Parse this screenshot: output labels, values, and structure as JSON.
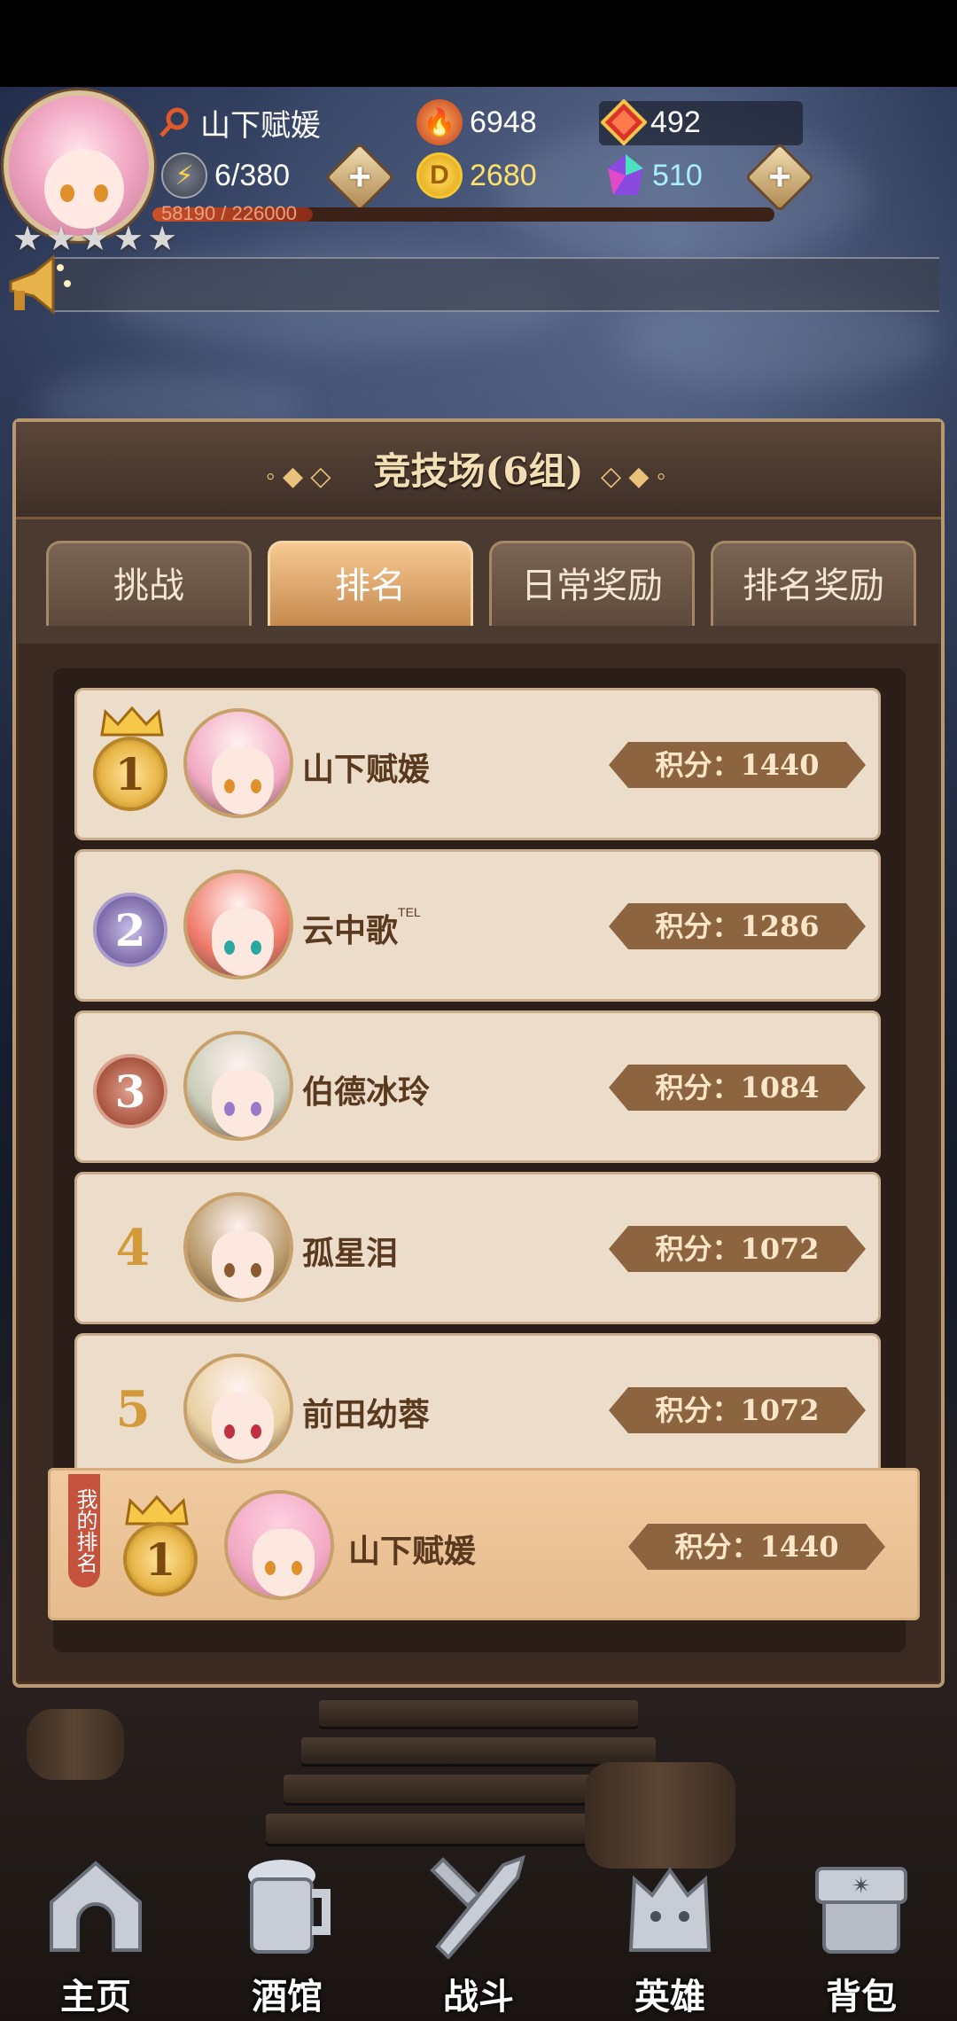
{
  "hud": {
    "player_name": "山下赋媛",
    "energy": "6/380",
    "exp_text": "58190 / 226000",
    "exp_fraction": 0.2575,
    "stars": 5,
    "power": "6948",
    "gold": "2680",
    "gems_red": "492",
    "gems_crystal": "510"
  },
  "panel": {
    "title": "竞技场(6组)",
    "tabs": [
      {
        "label": "挑战",
        "active": false
      },
      {
        "label": "排名",
        "active": true
      },
      {
        "label": "日常奖励",
        "active": false
      },
      {
        "label": "排名奖励",
        "active": false
      }
    ],
    "rankings": [
      {
        "rank": "1",
        "name": "山下赋媛",
        "sup": "",
        "score": "积分：1440",
        "medal": "gold",
        "hair": "#f2a9c4",
        "eye": "#e0902a"
      },
      {
        "rank": "2",
        "name": "云中歌",
        "sup": "TEL",
        "score": "积分：1286",
        "medal": "silver",
        "hair": "#f07a6a",
        "eye": "#2aa8a0"
      },
      {
        "rank": "3",
        "name": "伯德冰玲",
        "sup": "",
        "score": "积分：1084",
        "medal": "bronze",
        "hair": "#c9cdb8",
        "eye": "#9a7ac8"
      },
      {
        "rank": "4",
        "name": "孤星泪",
        "sup": "",
        "score": "积分：1072",
        "medal": "none",
        "hair": "#b89a6a",
        "eye": "#8a5a30"
      },
      {
        "rank": "5",
        "name": "前田幼蓉",
        "sup": "",
        "score": "积分：1072",
        "medal": "none",
        "hair": "#e8d0a0",
        "eye": "#c03040"
      }
    ],
    "my_rank": {
      "tag": "我的排名",
      "rank": "1",
      "name": "山下赋媛",
      "score": "积分：1440"
    }
  },
  "nav": [
    {
      "label": "主页",
      "icon": "home-icon"
    },
    {
      "label": "酒馆",
      "icon": "beer-mug-icon"
    },
    {
      "label": "战斗",
      "icon": "crossed-swords-icon"
    },
    {
      "label": "英雄",
      "icon": "cat-hero-icon"
    },
    {
      "label": "背包",
      "icon": "backpack-icon"
    }
  ],
  "colors": {
    "panel_bg": "#3a2a22",
    "row_bg": "#ecdcca",
    "score_badge": "#8c6440",
    "active_tab": "#e8a868"
  }
}
